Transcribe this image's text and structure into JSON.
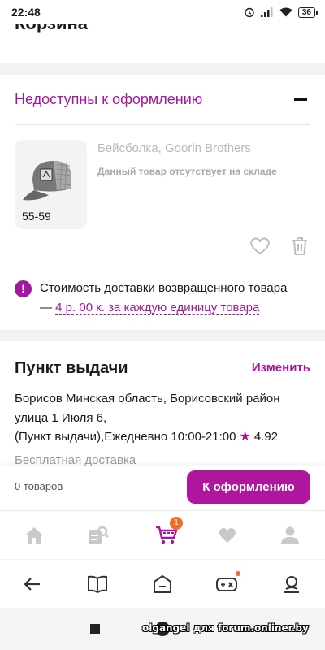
{
  "status_bar": {
    "time": "22:48",
    "battery": "36"
  },
  "cart": {
    "title": "Корзина"
  },
  "unavailable": {
    "title": "Недоступны к оформлению",
    "product": {
      "name": "Бейсболка, Goorin Brothers",
      "note": "Данный товар отсутствует на складе",
      "size": "55-59"
    },
    "notice_text": "Стоимость доставки возвращенного товара",
    "notice_dash": "—",
    "notice_link": "4 р. 00 к. за каждую единицу товара"
  },
  "pickup": {
    "title": "Пункт выдачи",
    "change_label": "Изменить",
    "address_line1": "Борисов Минская область, Борисовский район",
    "address_line2": "улица 1 Июля 6,",
    "address_line3": "(Пункт выдачи),Ежедневно 10:00-21:00",
    "rating": "4.92",
    "delivery": "Бесплатная доставка"
  },
  "checkout": {
    "items_count": "0 товаров",
    "button_label": "К оформлению"
  },
  "tabs": [
    {
      "icon": "home-icon"
    },
    {
      "icon": "catalog-search-icon"
    },
    {
      "icon": "cart-icon",
      "badge": "1",
      "active": true
    },
    {
      "icon": "heart-icon"
    },
    {
      "icon": "profile-icon"
    }
  ],
  "colors": {
    "accent": "#a1199c",
    "button": "#b0169d",
    "badge": "#f26a2e"
  },
  "watermark": "olgangel для forum.onliner.by"
}
